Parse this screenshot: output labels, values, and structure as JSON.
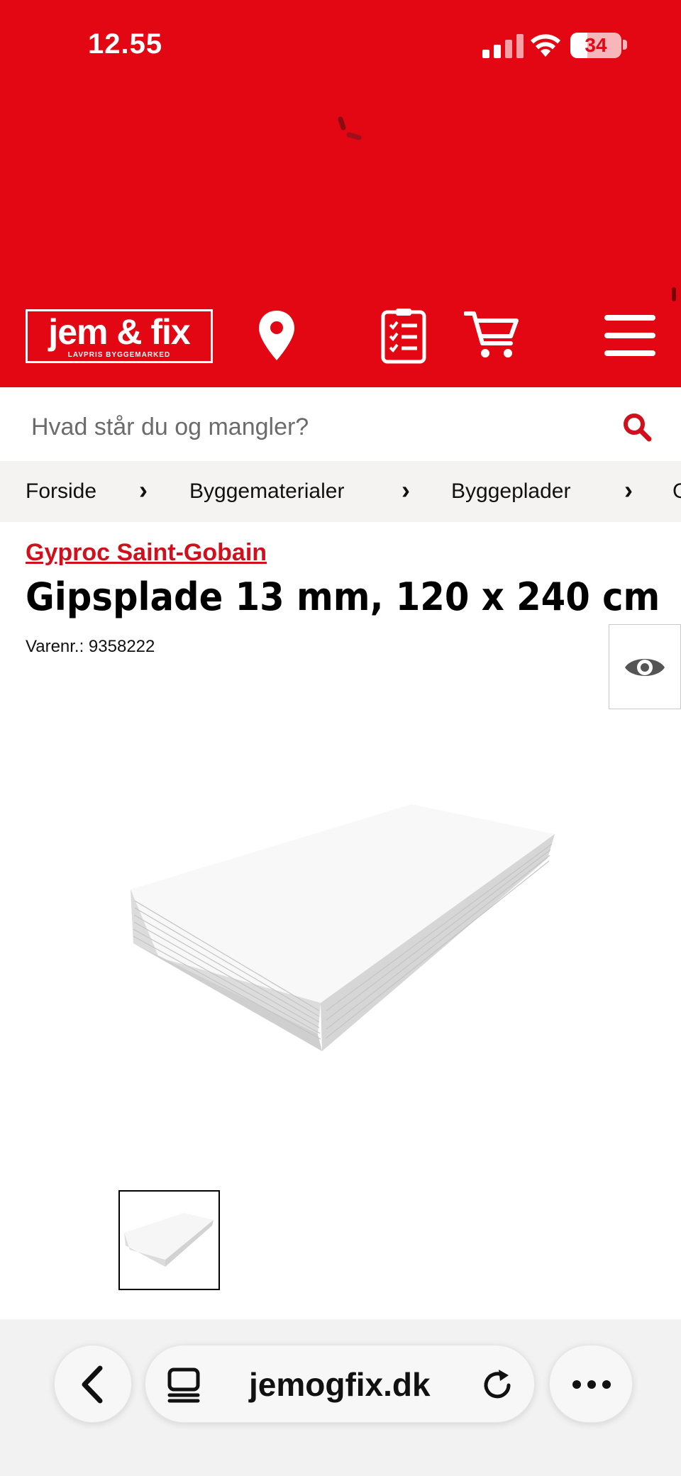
{
  "status_bar": {
    "time": "12.55",
    "battery": "34",
    "battery_level": 0.34
  },
  "header": {
    "logo_text": "jem & fix",
    "logo_tagline": "LAVPRIS BYGGEMARKED",
    "brand_color": "#e30613",
    "icons": [
      "location-pin-icon",
      "shopping-list-icon",
      "cart-icon",
      "menu-icon"
    ]
  },
  "search": {
    "placeholder": "Hvad står du og mangler?"
  },
  "breadcrumb": {
    "items": [
      "Forside",
      "Byggematerialer",
      "Byggeplader",
      "G"
    ],
    "separator": "›"
  },
  "product": {
    "brand": "Gyproc Saint-Gobain",
    "title": "Gipsplade 13 mm, 120 x 240 cm",
    "sku": "Varenr.: 9358222"
  },
  "browser": {
    "url": "jemogfix.dk"
  }
}
